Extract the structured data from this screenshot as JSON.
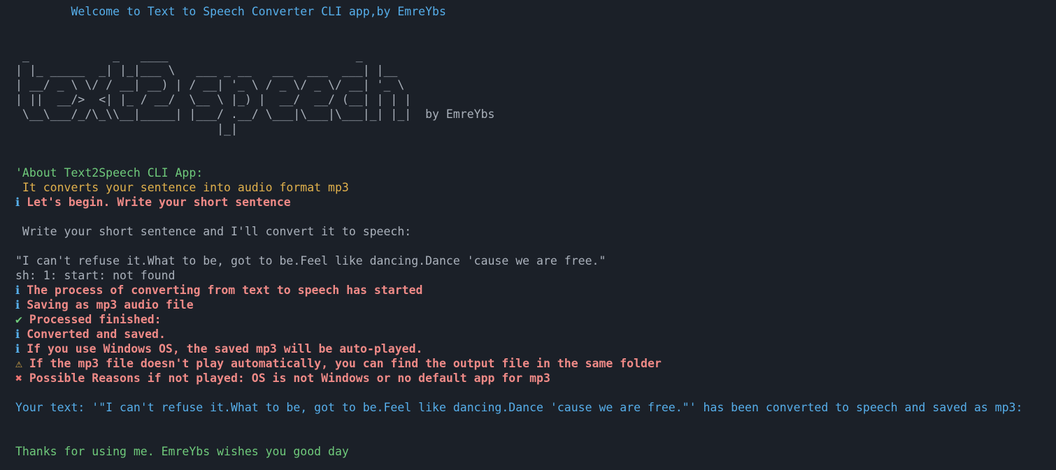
{
  "welcome": "        Welcome to Text to Speech Converter CLI app,by EmreYbs",
  "banner": {
    "lines": [
      " _            _   ____                           _",
      "| |_ _____  _| |_|___ \\   ___ _ __   ___  ___  ___| |__",
      "| __/ _ \\ \\/ / __| __) | / __| '_ \\ / _ \\/ _ \\/ __| '_ \\",
      "| ||  __/>  <| |_ / __/  \\__ \\ |_) |  __/  __/ (__| | | |",
      " \\__\\___/_/\\_\\\\__|_____| |___/ .__/ \\___|\\___|\\___|_| |_|  by EmreYbs",
      "                             |_|"
    ]
  },
  "about": {
    "title": "'About Text2Speech CLI App:",
    "description": " It converts your sentence into audio format mp3"
  },
  "begin_message": {
    "icon": "ℹ",
    "text": "Let's begin. Write your short sentence"
  },
  "prompt": " Write your short sentence and I'll convert it to speech:",
  "user_input": "\"I can't refuse it.What to be, got to be.Feel like dancing.Dance 'cause we are free.\"",
  "shell_error": "sh: 1: start: not found",
  "log": [
    {
      "type": "info",
      "icon": "ℹ",
      "text": "The process of converting from text to speech has started"
    },
    {
      "type": "info",
      "icon": "ℹ",
      "text": "Saving as mp3 audio file"
    },
    {
      "type": "success",
      "icon": "✔",
      "text": "Processed finished:"
    },
    {
      "type": "info",
      "icon": "ℹ",
      "text": "Converted and saved."
    },
    {
      "type": "info",
      "icon": "ℹ",
      "text": "If you use Windows OS, the saved mp3 will be auto-played."
    },
    {
      "type": "warning",
      "icon": "⚠",
      "text": "If the mp3 file doesn't play automatically, you can find the output file in the same folder"
    },
    {
      "type": "error",
      "icon": "✖",
      "text": "Possible Reasons if not played: OS is not Windows or no default app for mp3"
    }
  ],
  "result": "Your text: '\"I can't refuse it.What to be, got to be.Feel like dancing.Dance 'cause we are free.\"' has been converted to speech and saved as mp3:",
  "farewell": "Thanks for using me. EmreYbs wishes you good day",
  "colors": {
    "background": "#1b2028",
    "blue": "#56aeea",
    "gray": "#aab1bb",
    "green": "#6fca7b",
    "yellow": "#e0b04c",
    "red": "#ef8a87"
  }
}
